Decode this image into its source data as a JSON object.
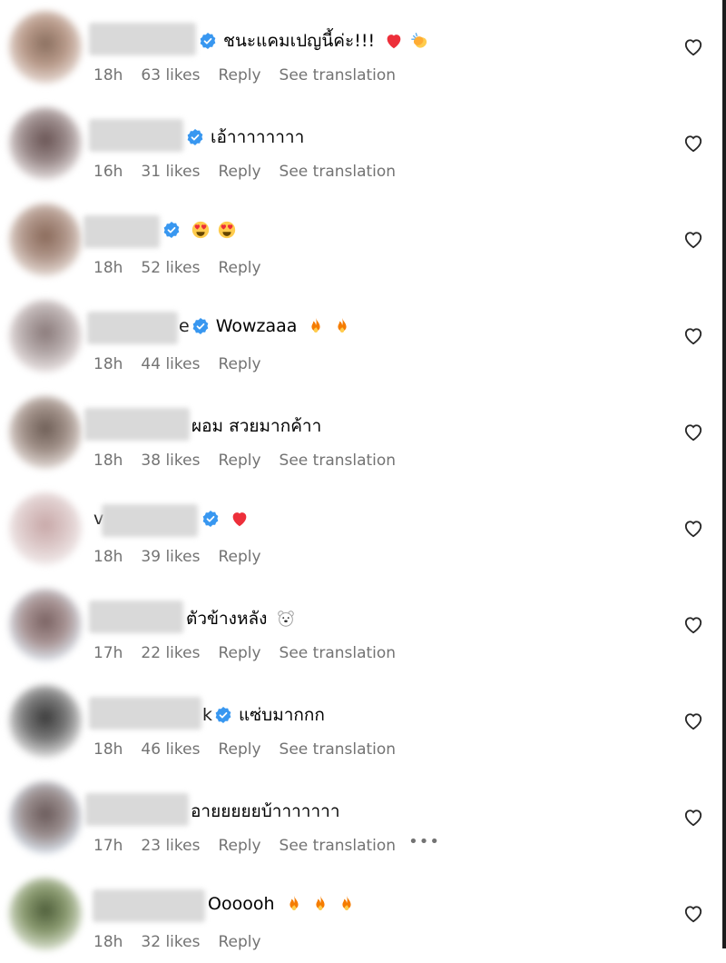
{
  "comments": [
    {
      "text": "ชนะแคมเปญนี้ค่ะ!!!",
      "verified": true,
      "emojis": [
        "red-heart",
        "clapping-hands"
      ],
      "time": "18h",
      "likes": "63 likes",
      "reply": "Reply",
      "translation": "See translation"
    },
    {
      "text": "เอ้าาาาาาาา",
      "verified": true,
      "emojis": [],
      "time": "16h",
      "likes": "31 likes",
      "reply": "Reply",
      "translation": "See translation"
    },
    {
      "text": "",
      "verified": true,
      "emojis": [
        "heart-eyes",
        "heart-eyes"
      ],
      "time": "18h",
      "likes": "52 likes",
      "reply": "Reply",
      "translation": ""
    },
    {
      "name_tail": "e",
      "text": "Wowzaaa",
      "verified": true,
      "emojis": [
        "fire",
        "fire"
      ],
      "time": "18h",
      "likes": "44 likes",
      "reply": "Reply",
      "translation": ""
    },
    {
      "text": "ผอม สวยมากค้าา",
      "verified": false,
      "emojis": [],
      "time": "18h",
      "likes": "38 likes",
      "reply": "Reply",
      "translation": "See translation"
    },
    {
      "name_head": "v",
      "text": "",
      "verified": true,
      "emojis": [
        "red-heart"
      ],
      "time": "18h",
      "likes": "39 likes",
      "reply": "Reply",
      "translation": ""
    },
    {
      "text": "ตัวข้างหลัง",
      "verified": false,
      "emojis": [
        "polar-bear"
      ],
      "time": "17h",
      "likes": "22 likes",
      "reply": "Reply",
      "translation": "See translation"
    },
    {
      "name_tail": "k",
      "text": "แซ่บมากกก",
      "verified": true,
      "emojis": [],
      "time": "18h",
      "likes": "46 likes",
      "reply": "Reply",
      "translation": "See translation"
    },
    {
      "text": "อายยยยยบ้าาาาาาา",
      "verified": false,
      "emojis": [],
      "time": "17h",
      "likes": "23 likes",
      "reply": "Reply",
      "translation": "See translation",
      "more": "•••"
    },
    {
      "text": "Oooooh",
      "verified": false,
      "emojis": [
        "fire",
        "fire",
        "fire"
      ],
      "time": "18h",
      "likes": "32 likes",
      "reply": "Reply",
      "translation": ""
    }
  ],
  "colors": {
    "verified": "#3897f0",
    "meta_text": "#737373",
    "heart_red": "#ed2f3a",
    "fire": "#f57c00"
  }
}
